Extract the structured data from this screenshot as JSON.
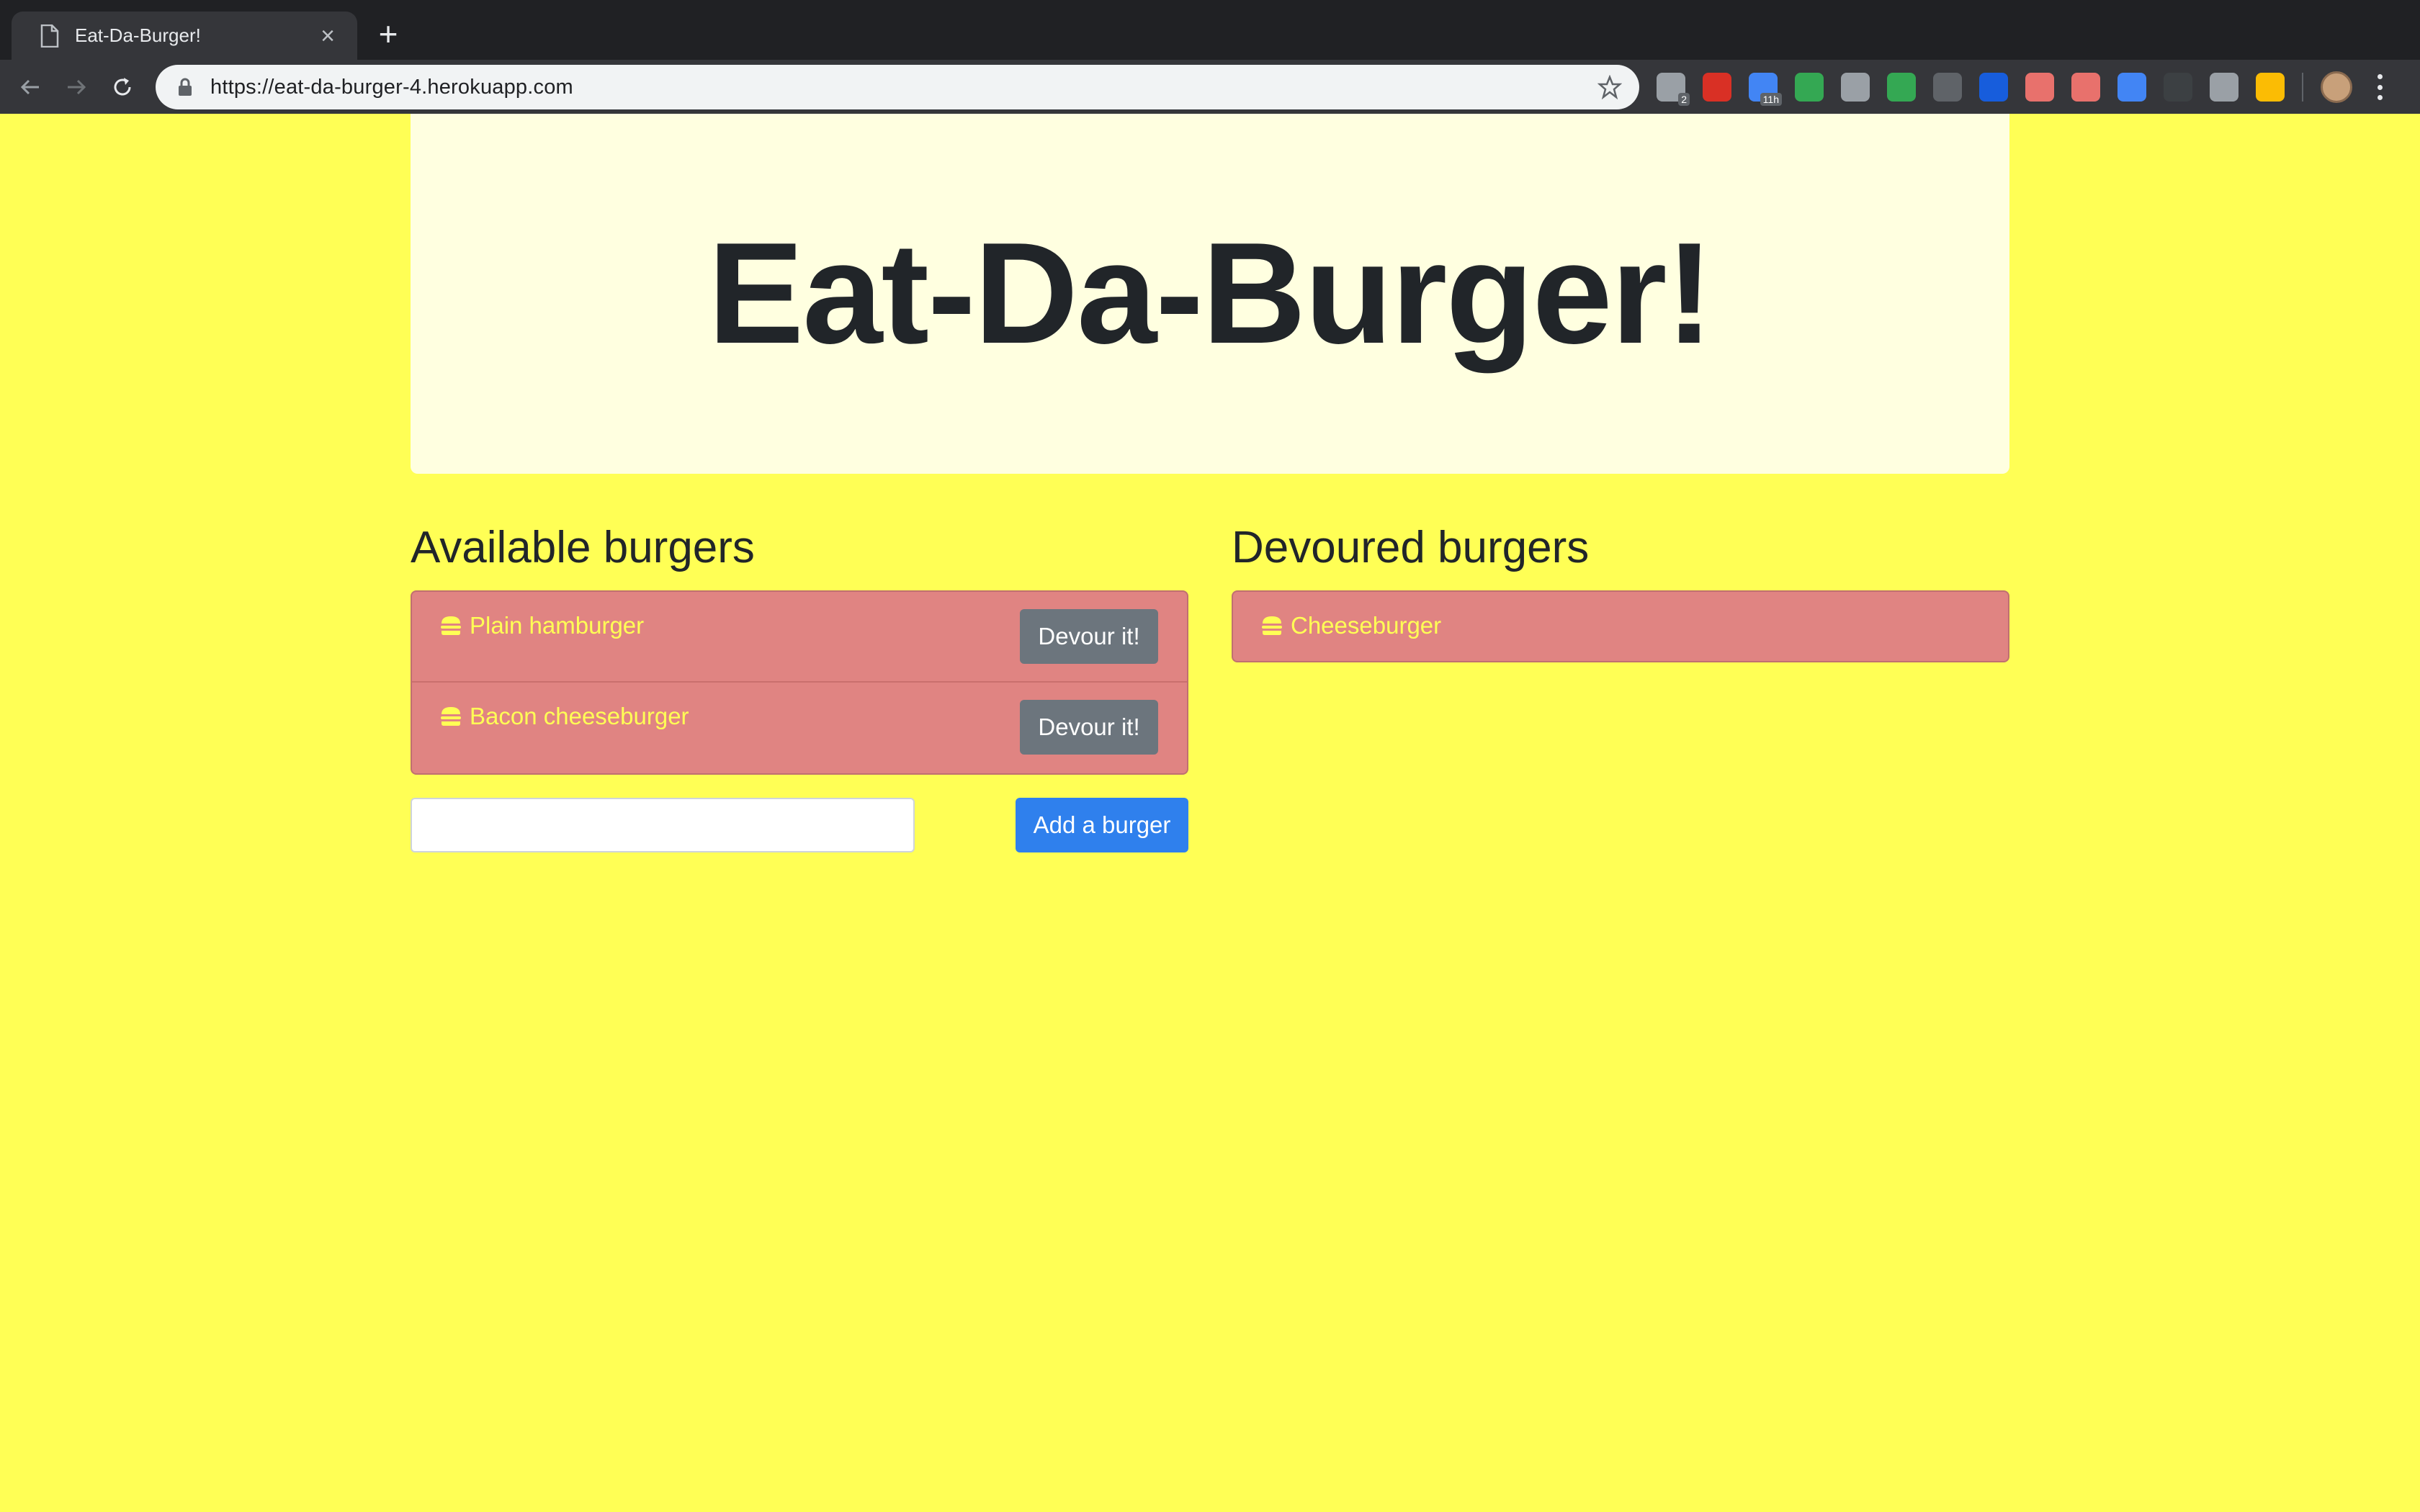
{
  "browser": {
    "tab_title": "Eat-Da-Burger!",
    "tab_close": "×",
    "new_tab": "+",
    "url": "https://eat-da-burger-4.herokuapp.com",
    "extensions": [
      {
        "icon": "mail-icon",
        "color": "#9aa0a6",
        "badge": "2"
      },
      {
        "icon": "gmail-icon",
        "color": "#d93025",
        "badge": ""
      },
      {
        "icon": "calendar-icon",
        "color": "#4285f4",
        "badge": "11h"
      },
      {
        "icon": "drive-icon",
        "color": "#34a853",
        "badge": ""
      },
      {
        "icon": "keep-icon",
        "color": "#9aa0a6",
        "badge": ""
      },
      {
        "icon": "checkmark-icon",
        "color": "#34a853",
        "badge": ""
      },
      {
        "icon": "toggle-icon",
        "color": "#5f6368",
        "badge": ""
      },
      {
        "icon": "bitwarden-icon",
        "color": "#175ddc",
        "badge": ""
      },
      {
        "icon": "arrow-icon",
        "color": "#e8716c",
        "badge": ""
      },
      {
        "icon": "cross-icon",
        "color": "#e8716c",
        "badge": ""
      },
      {
        "icon": "dropper-icon",
        "color": "#4285f4",
        "badge": ""
      },
      {
        "icon": "dark-circle-icon",
        "color": "#3c4043",
        "badge": ""
      },
      {
        "icon": "cloud-icon",
        "color": "#9aa0a6",
        "badge": ""
      },
      {
        "icon": "compass-icon",
        "color": "#fbbc04",
        "badge": ""
      }
    ]
  },
  "page": {
    "title": "Eat-Da-Burger!",
    "available": {
      "heading": "Available burgers",
      "items": [
        {
          "name": "Plain hamburger",
          "button": "Devour it!"
        },
        {
          "name": "Bacon cheeseburger",
          "button": "Devour it!"
        }
      ]
    },
    "devoured": {
      "heading": "Devoured burgers",
      "items": [
        {
          "name": "Cheeseburger"
        }
      ]
    },
    "form": {
      "input_value": "",
      "input_placeholder": "",
      "submit_label": "Add a burger"
    }
  }
}
